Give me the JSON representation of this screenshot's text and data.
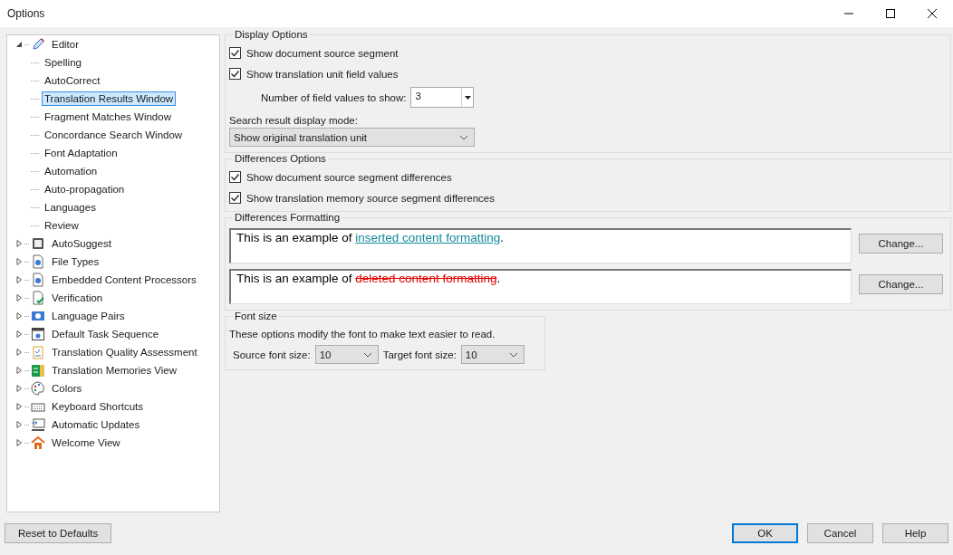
{
  "window": {
    "title": "Options"
  },
  "tree": [
    {
      "label": "Editor",
      "expanded": true,
      "selected": false,
      "children": [
        {
          "label": "Spelling",
          "selected": false
        },
        {
          "label": "AutoCorrect",
          "selected": false
        },
        {
          "label": "Translation Results Window",
          "selected": true
        },
        {
          "label": "Fragment Matches Window",
          "selected": false
        },
        {
          "label": "Concordance Search Window",
          "selected": false
        },
        {
          "label": "Font Adaptation",
          "selected": false
        },
        {
          "label": "Automation",
          "selected": false
        },
        {
          "label": "Auto-propagation",
          "selected": false
        },
        {
          "label": "Languages",
          "selected": false
        },
        {
          "label": "Review",
          "selected": false
        }
      ]
    },
    {
      "label": "AutoSuggest",
      "expanded": false,
      "selected": false
    },
    {
      "label": "File Types",
      "expanded": false,
      "selected": false
    },
    {
      "label": "Embedded Content Processors",
      "expanded": false,
      "selected": false
    },
    {
      "label": "Verification",
      "expanded": false,
      "selected": false
    },
    {
      "label": "Language Pairs",
      "expanded": false,
      "selected": false
    },
    {
      "label": "Default Task Sequence",
      "expanded": false,
      "selected": false
    },
    {
      "label": "Translation Quality Assessment",
      "expanded": false,
      "selected": false
    },
    {
      "label": "Translation Memories View",
      "expanded": false,
      "selected": false
    },
    {
      "label": "Colors",
      "expanded": false,
      "selected": false
    },
    {
      "label": "Keyboard Shortcuts",
      "expanded": false,
      "selected": false
    },
    {
      "label": "Automatic Updates",
      "expanded": false,
      "selected": false
    },
    {
      "label": "Welcome View",
      "expanded": false,
      "selected": false
    }
  ],
  "display_options": {
    "title": "Display Options",
    "checkboxes": [
      {
        "label": "Show document source segment",
        "checked": true
      },
      {
        "label": "Show translation unit field values",
        "checked": true
      }
    ],
    "field_count": {
      "label": "Number of field values to show:",
      "value": "3"
    },
    "search_mode": {
      "label": "Search result display mode:",
      "value": "Show original translation unit"
    }
  },
  "differences_options": {
    "title": "Differences Options",
    "checkboxes": [
      {
        "label": "Show document source segment differences",
        "checked": true
      },
      {
        "label": "Show translation memory source segment differences",
        "checked": true
      }
    ]
  },
  "differences_formatting": {
    "title": "Differences Formatting",
    "samples": [
      {
        "kind": "inserted",
        "before": "This is an example of ",
        "sample": "inserted content formatting",
        "after": ".",
        "button": "Change..."
      },
      {
        "kind": "deleted",
        "before": "This is an example of ",
        "sample": "deleted content formatting",
        "after": ".",
        "button": "Change..."
      }
    ]
  },
  "font_size": {
    "title": "Font size",
    "description": "These options modify the font to make text easier to read.",
    "source": {
      "label": "Source font size:",
      "value": "10"
    },
    "target": {
      "label": "Target font size:",
      "value": "10"
    }
  },
  "buttons": {
    "reset": "Reset to Defaults",
    "ok": "OK",
    "cancel": "Cancel",
    "help": "Help"
  }
}
